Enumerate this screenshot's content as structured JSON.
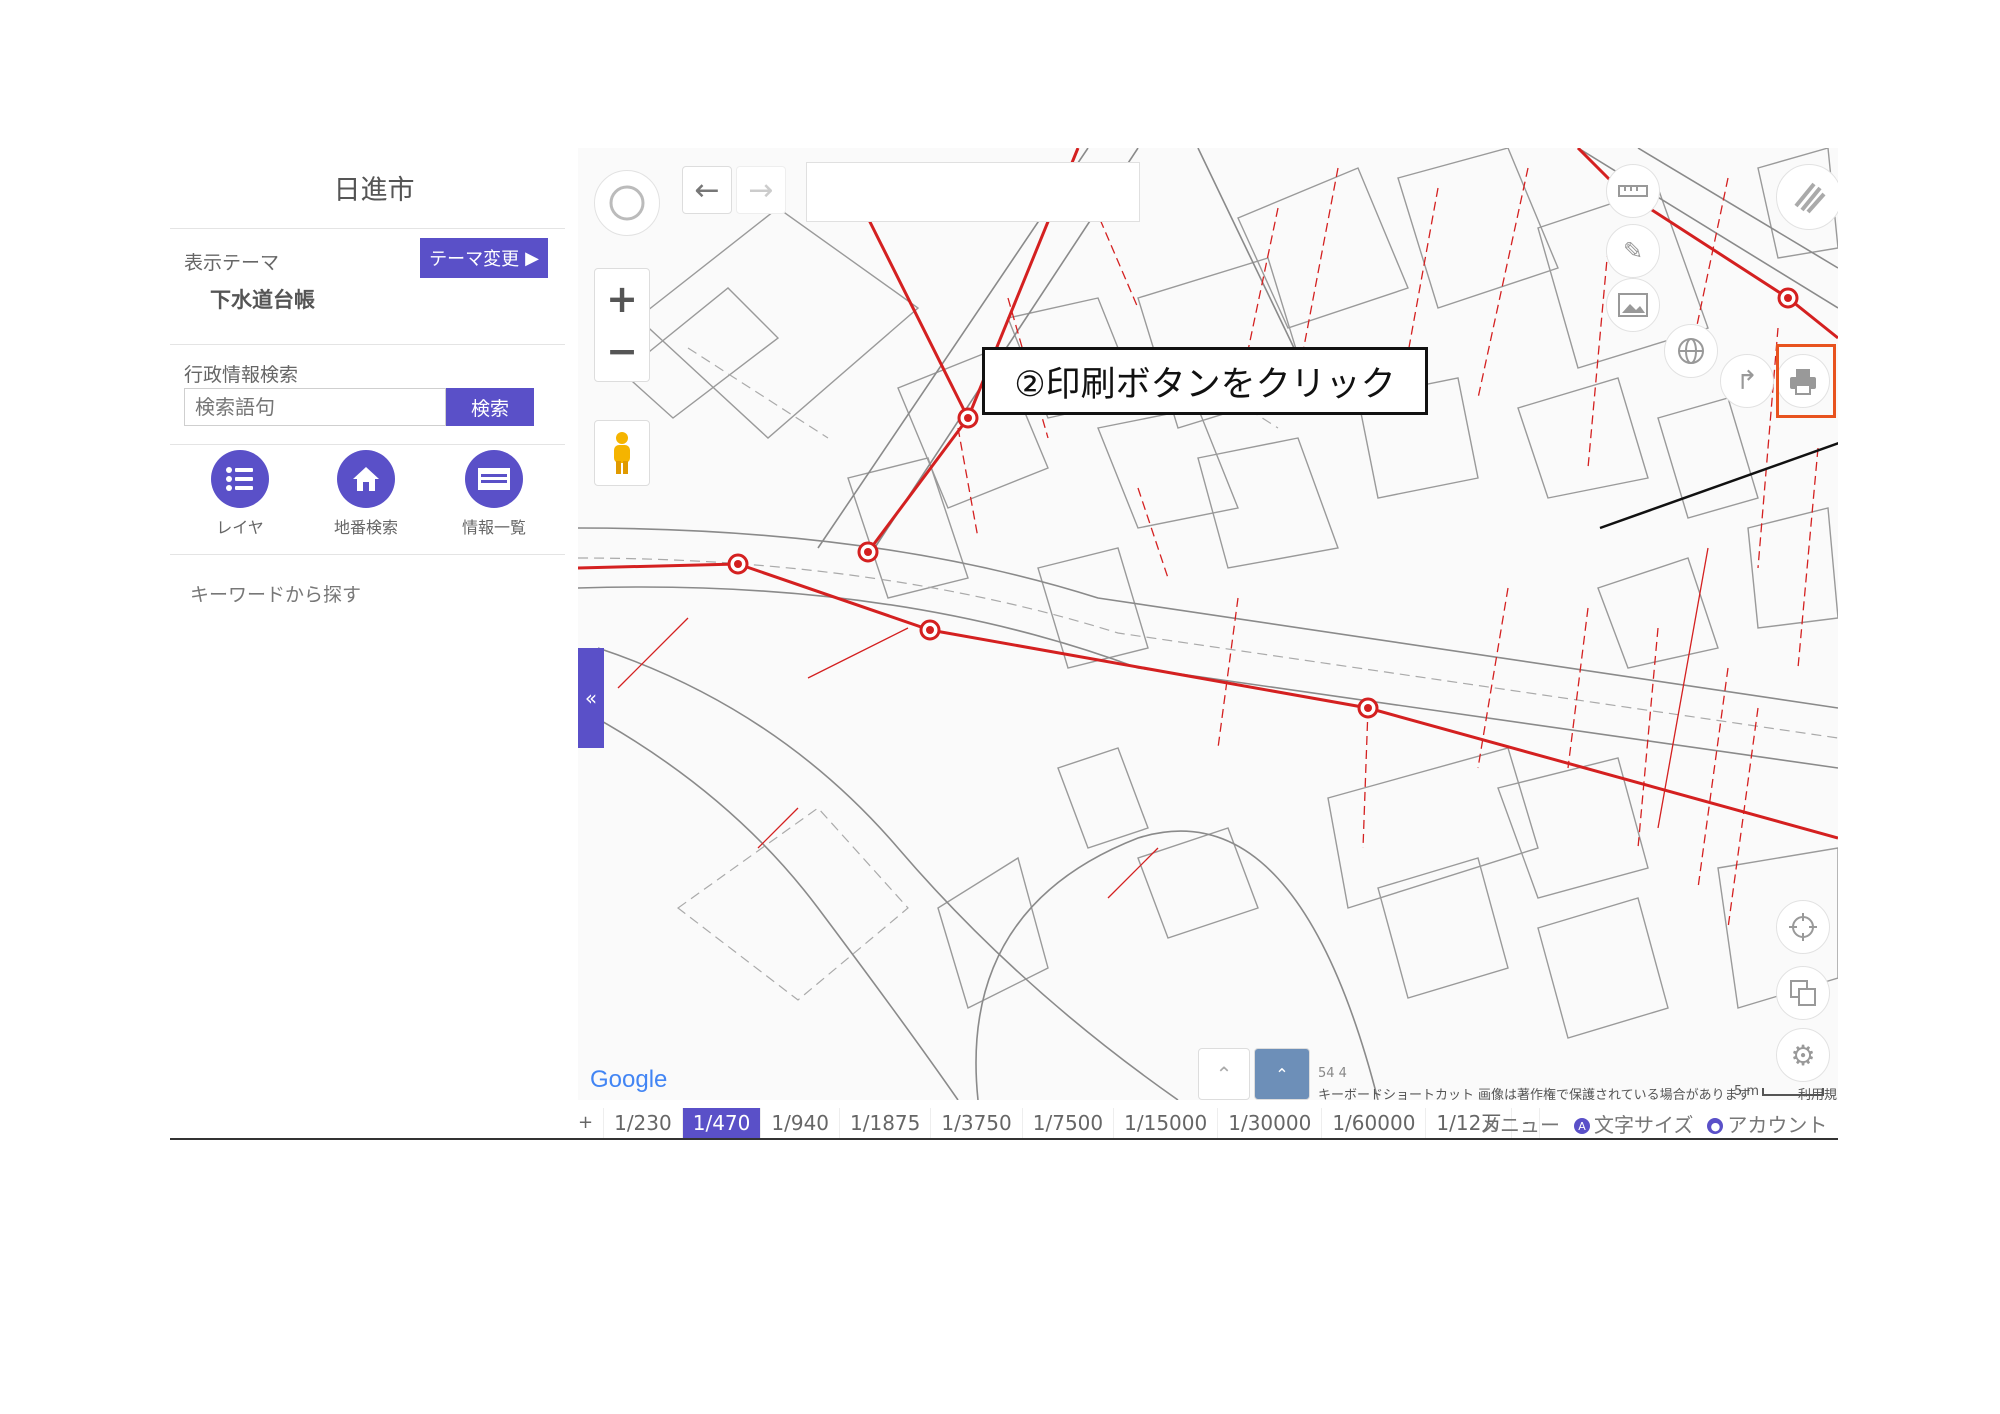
{
  "sidebar": {
    "city": "日進市",
    "theme_label": "表示テーマ",
    "theme_change_label": "テーマ変更",
    "theme_name": "下水道台帳",
    "admin_search_label": "行政情報検索",
    "search_placeholder": "検索語句",
    "search_button_label": "検索",
    "icon_buttons": [
      {
        "label": "レイヤ",
        "icon": "list-icon"
      },
      {
        "label": "地番検索",
        "icon": "house-icon"
      },
      {
        "label": "情報一覧",
        "icon": "table-icon"
      }
    ],
    "keyword_label": "キーワードから探す"
  },
  "map": {
    "google_logo": "Google",
    "keyboard_shortcuts": "キーボードショートカット",
    "copyright_notice": "画像は著作権で保護されている場合があります",
    "scale_label": "5 m",
    "terms": "利用規約",
    "numbers": "54 4"
  },
  "annotation": {
    "callout_text": "②印刷ボタンをクリック",
    "highlight_color": "#e8531f"
  },
  "scale_bar": {
    "zoom_in": "+",
    "zoom_out": "-",
    "scales": [
      "1/230",
      "1/470",
      "1/940",
      "1/1875",
      "1/3750",
      "1/7500",
      "1/15000",
      "1/30000",
      "1/60000",
      "1/12万"
    ],
    "active_scale": "1/470"
  },
  "footer_links": {
    "menu": "メニュー",
    "font_size": "文字サイズ",
    "account": "アカウント"
  },
  "colors": {
    "accent": "#5a50c8",
    "pipe": "#d42020"
  }
}
